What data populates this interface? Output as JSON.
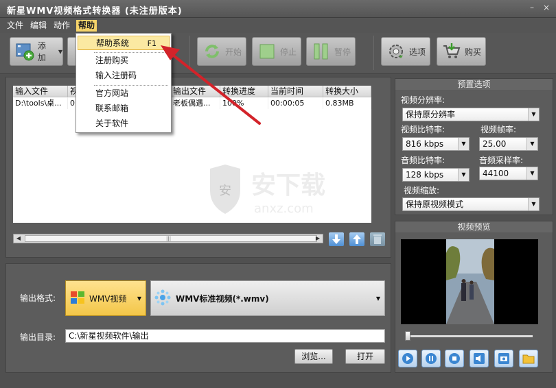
{
  "window": {
    "title": "新星WMV视频格式转换器 (未注册版本)"
  },
  "menu": {
    "items": [
      "文件",
      "编辑",
      "动作",
      "帮助"
    ]
  },
  "help_menu": {
    "items": [
      {
        "label": "帮助系统",
        "shortcut": "F1"
      },
      {
        "label": "注册购买"
      },
      {
        "label": "输入注册码"
      },
      {
        "label": "官方网站"
      },
      {
        "label": "联系邮箱"
      },
      {
        "label": "关于软件"
      }
    ]
  },
  "toolbar": {
    "add_label": "添加",
    "start_label": "开始",
    "stop_label": "停止",
    "pause_label": "暂停",
    "options_label": "选项",
    "buy_label": "购买"
  },
  "file_table": {
    "columns": [
      "输入文件",
      "视",
      "",
      "",
      "输出文件",
      "转换进度",
      "当前时间",
      "转换大小"
    ],
    "rows": [
      [
        "D:\\tools\\桌...",
        "0",
        "",
        "",
        "老板偶遇...",
        "100%",
        "00:00:05",
        "0.83MB"
      ]
    ]
  },
  "output": {
    "format_label": "输出格式:",
    "format_value": "WMV视频",
    "profile_value": "WMV标准视频(*.wmv)",
    "dir_label": "输出目录:",
    "dir_value": "C:\\新星视频软件\\输出",
    "browse_label": "浏览...",
    "open_label": "打开"
  },
  "presets": {
    "title": "预置选项",
    "resolution_label": "视频分辨率:",
    "resolution_value": "保持原分辨率",
    "vbitrate_label": "视频比特率:",
    "vbitrate_value": "816 kbps",
    "framerate_label": "视频帧率:",
    "framerate_value": "25.00",
    "abitrate_label": "音频比特率:",
    "abitrate_value": "128 kbps",
    "samplerate_label": "音频采样率:",
    "samplerate_value": "44100",
    "scale_label": "视频缩放:",
    "scale_value": "保持原视频模式"
  },
  "preview": {
    "title": "视频预览",
    "position": 0.0
  },
  "watermark": {
    "text": "安下载",
    "subtext": "anxz.com"
  },
  "colors": {
    "accent": "#f3c648",
    "menu_highlight": "#fbe9a2",
    "arrow": "#d3232a"
  }
}
